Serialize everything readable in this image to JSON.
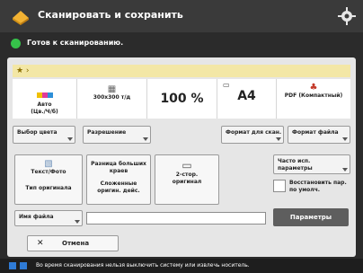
{
  "title": "Сканировать и сохранить",
  "status": "Готов к сканированию.",
  "cells": {
    "color_label_line1": "Авто",
    "color_label_line2": "(Цв./Ч/б)",
    "resolution_value": "300x300 т/д",
    "zoom_value": "100 %",
    "paper_value": "A4",
    "filetype_label": "PDF (Компактный)"
  },
  "buttons": {
    "select_color": "Выбор цвета",
    "resolution": "Разрешение",
    "scan_size": "Формат для скан.",
    "file_format": "Формат файла",
    "text_photo_line1": "Текст/Фото",
    "text_photo_line2": "Тип оригинала",
    "fold_line1": "Разница больших",
    "fold_line2": "краев",
    "density_line1": "Сложенные",
    "density_line2": "оригин. дейс.",
    "duplex_line1": "2-стор.",
    "duplex_line2": "оригинал",
    "frequent_line1": "Часто исп.",
    "frequent_line2": "параметры",
    "restore_line1": "Восстановить пар.",
    "restore_line2": "по умолч.",
    "file_name": "Имя файла",
    "params": "Параметры",
    "cancel": "Отмена"
  },
  "footer_text": "Во время сканирования нельзя выключить систему или извлечь носитель."
}
